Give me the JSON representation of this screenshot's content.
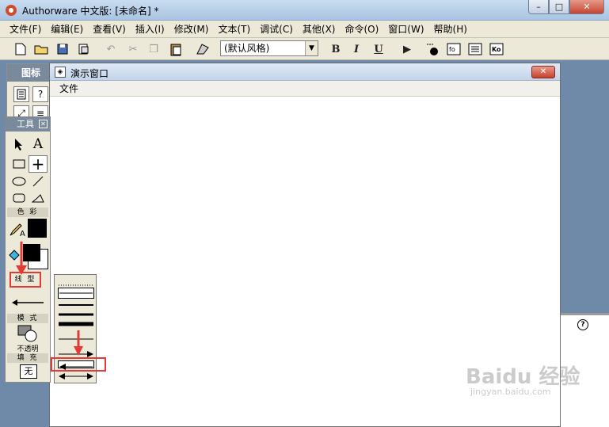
{
  "window": {
    "title": "Authorware 中文版: [未命名] *",
    "minimize": "–",
    "maximize": "□",
    "close": "✕"
  },
  "menu": [
    "文件(F)",
    "编辑(E)",
    "查看(V)",
    "插入(I)",
    "修改(M)",
    "文本(T)",
    "调试(C)",
    "其他(X)",
    "命令(O)",
    "窗口(W)",
    "帮助(H)"
  ],
  "toolbar": {
    "style_select": "(默认风格)",
    "bold": "B",
    "italic": "I",
    "underline": "U"
  },
  "icons_palette": {
    "title": "图标"
  },
  "tools_palette": {
    "title": "工具",
    "color_label": "色 彩",
    "linestyle_label": "线 型",
    "mode_label": "模 式",
    "mode_value": "不透明",
    "fill_label": "填 充",
    "fill_value": "无"
  },
  "presentation": {
    "title": "演示窗口",
    "menu_file": "文件"
  },
  "watermark": {
    "brand": "Baidu 经验",
    "url": "jingyan.baidu.com"
  },
  "colors": {
    "highlight": "#e53935",
    "palette_title": "#7a8a9d"
  }
}
